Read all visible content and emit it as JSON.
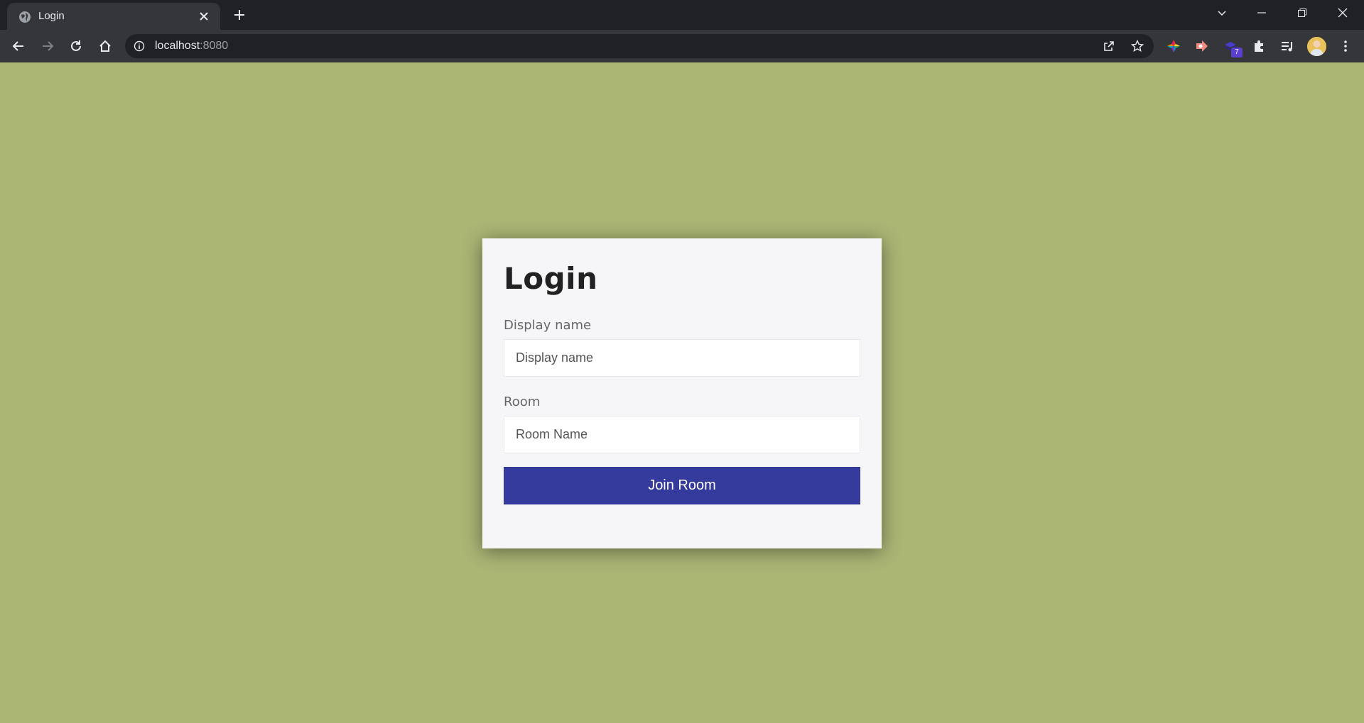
{
  "browser": {
    "tab_title": "Login",
    "url_host": "localhost",
    "url_port": ":8080",
    "extension_badge": "7"
  },
  "login": {
    "heading": "Login",
    "display_name_label": "Display name",
    "display_name_placeholder": "Display name",
    "room_label": "Room",
    "room_placeholder": "Room Name",
    "join_button": "Join Room"
  },
  "colors": {
    "page_background": "#abb675",
    "card_background": "#f6f6f9",
    "button_background": "#353b9c"
  }
}
